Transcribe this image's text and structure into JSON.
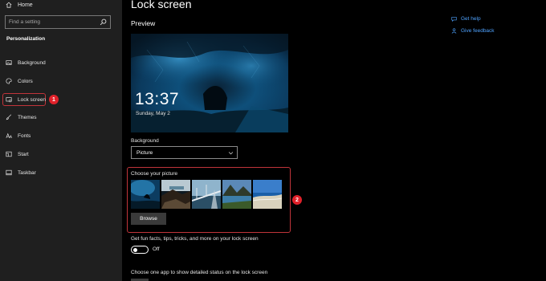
{
  "sidebar": {
    "home_label": "Home",
    "search_placeholder": "Find a setting",
    "section_title": "Personalization",
    "items": [
      {
        "label": "Background",
        "icon": "image-icon"
      },
      {
        "label": "Colors",
        "icon": "palette-icon"
      },
      {
        "label": "Lock screen",
        "icon": "lock-screen-icon",
        "selected": true
      },
      {
        "label": "Themes",
        "icon": "brush-icon"
      },
      {
        "label": "Fonts",
        "icon": "font-icon"
      },
      {
        "label": "Start",
        "icon": "start-icon"
      },
      {
        "label": "Taskbar",
        "icon": "taskbar-icon"
      }
    ]
  },
  "annotations": {
    "badge1": "1",
    "badge2": "2",
    "highlight_color": "#c0343a",
    "badge_color": "#e1212a"
  },
  "main": {
    "title": "Lock screen",
    "preview_label": "Preview",
    "preview_time": "13:37",
    "preview_date": "Sunday, May 2",
    "background_label": "Background",
    "background_value": "Picture",
    "choose_picture_label": "Choose your picture",
    "browse_label": "Browse",
    "fun_facts_label": "Get fun facts, tips, tricks, and more on your lock screen",
    "fun_facts_toggle": "Off",
    "status_label": "Choose one app to show detailed status on the lock screen"
  },
  "help": {
    "get_help": "Get help",
    "give_feedback": "Give feedback",
    "link_color": "#4fa3ff"
  }
}
